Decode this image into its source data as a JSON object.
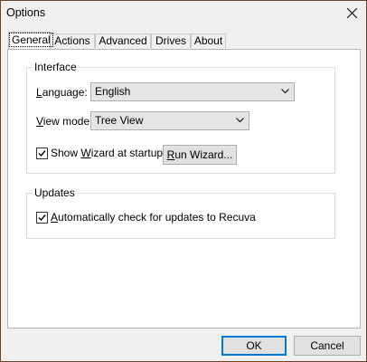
{
  "window": {
    "title": "Options"
  },
  "tabs": [
    {
      "label": "General"
    },
    {
      "label": "Actions"
    },
    {
      "label": "Advanced"
    },
    {
      "label": "Drives"
    },
    {
      "label": "About"
    }
  ],
  "interface_group": {
    "title": "Interface",
    "language_label": "Language:",
    "language_value": "English",
    "view_mode_label": "View mode",
    "view_mode_value": "Tree View",
    "show_wizard_label": "Show Wizard at startup",
    "show_wizard_checked": true,
    "run_wizard_label": "Run Wizard..."
  },
  "updates_group": {
    "title": "Updates",
    "auto_check_label": "Automatically check for updates to Recuva",
    "auto_check_checked": true
  },
  "footer": {
    "ok_label": "OK",
    "cancel_label": "Cancel"
  }
}
